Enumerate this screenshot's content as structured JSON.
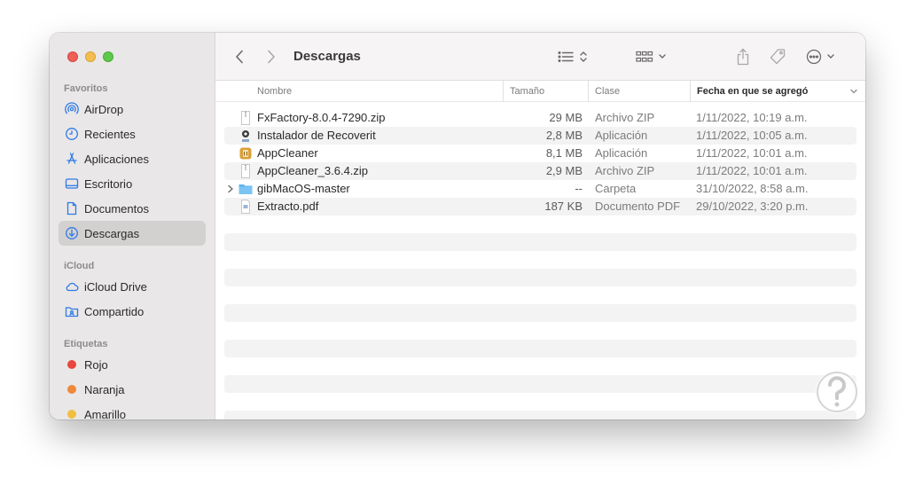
{
  "window": {
    "title": "Descargas"
  },
  "sidebar": {
    "sections": [
      {
        "title": "Favoritos",
        "items": [
          {
            "label": "AirDrop",
            "icon": "airdrop-icon"
          },
          {
            "label": "Recientes",
            "icon": "clock-icon"
          },
          {
            "label": "Aplicaciones",
            "icon": "applications-icon"
          },
          {
            "label": "Escritorio",
            "icon": "desktop-icon"
          },
          {
            "label": "Documentos",
            "icon": "document-icon"
          },
          {
            "label": "Descargas",
            "icon": "downloads-icon",
            "selected": true
          }
        ]
      },
      {
        "title": "iCloud",
        "items": [
          {
            "label": "iCloud Drive",
            "icon": "cloud-icon"
          },
          {
            "label": "Compartido",
            "icon": "shared-folder-icon"
          }
        ]
      },
      {
        "title": "Etiquetas",
        "items": [
          {
            "label": "Rojo",
            "color": "#e9443e"
          },
          {
            "label": "Naranja",
            "color": "#f0883b"
          },
          {
            "label": "Amarillo",
            "color": "#f2be3e"
          }
        ]
      }
    ]
  },
  "columns": {
    "name": "Nombre",
    "size": "Tamaño",
    "kind": "Clase",
    "date": "Fecha en que se agregó"
  },
  "files": [
    {
      "name": "FxFactory-8.0.4-7290.zip",
      "size": "29 MB",
      "kind": "Archivo ZIP",
      "date": "1/11/2022, 10:19 a.m.",
      "icon": "zip-file-icon"
    },
    {
      "name": "Instalador de Recoverit",
      "size": "2,8 MB",
      "kind": "Aplicación",
      "date": "1/11/2022, 10:05 a.m.",
      "icon": "installer-app-icon"
    },
    {
      "name": "AppCleaner",
      "size": "8,1 MB",
      "kind": "Aplicación",
      "date": "1/11/2022, 10:01 a.m.",
      "icon": "appcleaner-app-icon"
    },
    {
      "name": "AppCleaner_3.6.4.zip",
      "size": "2,9 MB",
      "kind": "Archivo ZIP",
      "date": "1/11/2022, 10:01 a.m.",
      "icon": "zip-file-icon"
    },
    {
      "name": "gibMacOS-master",
      "size": "--",
      "kind": "Carpeta",
      "date": "31/10/2022, 8:58 a.m.",
      "icon": "folder-icon"
    },
    {
      "name": "Extracto.pdf",
      "size": "187 KB",
      "kind": "Documento PDF",
      "date": "29/10/2022, 3:20 p.m.",
      "icon": "pdf-file-icon"
    }
  ]
}
